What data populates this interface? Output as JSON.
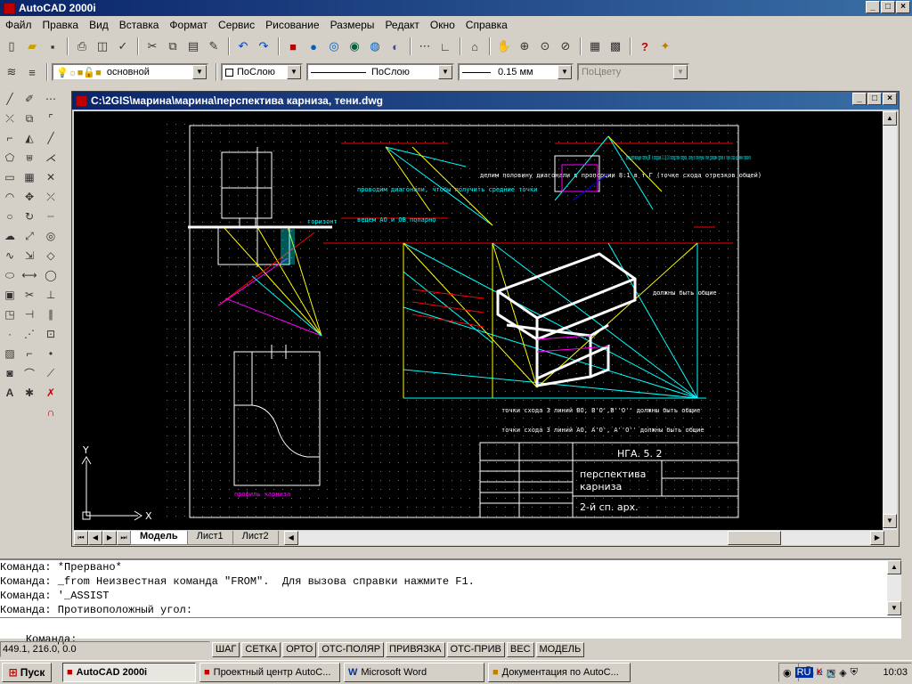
{
  "window": {
    "title": "AutoCAD 2000i",
    "controls": [
      "_",
      "□",
      "×"
    ]
  },
  "menu": [
    "Файл",
    "Правка",
    "Вид",
    "Вставка",
    "Формат",
    "Сервис",
    "Рисование",
    "Размеры",
    "Редакт",
    "Окно",
    "Справка"
  ],
  "layers": {
    "current_layer": "основной",
    "color": "ПоСлою",
    "linetype": "ПоСлою",
    "lineweight": "0.15 мм",
    "plotstyle": "ПоЦвету"
  },
  "drawing": {
    "title": "C:\\2GIS\\марина\\марина\\перспектива карниза, тени.dwg",
    "tabs": [
      "Модель",
      "Лист1",
      "Лист2"
    ],
    "active_tab": "Модель",
    "notes": {
      "divide_halves": "делим половину диагонали в пропорции 8:1 в т.Г (точке схода отрезков общей)",
      "draw_diag": "проводим диагонали, чтобы получить средние точки",
      "draw_lines": "ведем АО и ОВ попарно",
      "vertical_note": "делим вертикальные отрезки BB' в пропорции 1:1:8:1:8 посредством отрезков, затем из полученных точек проводим отрезки в точки схода на линии горизонта",
      "must_be_common": "должны быть общие",
      "vp_note_1": "точки схода 3 линий ВО, В'О',В''О'' должны быть общие",
      "vp_note_2": "точки схода 3 линий АО, А'О', А''О'' должны быть общие",
      "profile_label": "профиль карниза",
      "horizon": "горизонт"
    },
    "title_block": {
      "code": "НГА. 5. 2",
      "name_line1": "перспектива",
      "name_line2": "карниза",
      "course": "2-й сп. арх."
    },
    "ucs": {
      "x": "X",
      "y": "Y"
    }
  },
  "command": {
    "history": [
      "Команда: *Прервано*",
      "Команда: _from Неизвестная команда \"FROM\".  Для вызова справки нажмите F1.",
      "Команда: '_ASSIST",
      "Команда: Противоположный угол:"
    ],
    "prompt": "Команда:"
  },
  "status": {
    "coords": "449.1, 216.0, 0.0",
    "toggles": [
      "ШАГ",
      "СЕТКА",
      "ОРТО",
      "ОТС-ПОЛЯР",
      "ПРИВЯЗКА",
      "ОТС-ПРИВ",
      "ВЕС",
      "МОДЕЛЬ"
    ]
  },
  "taskbar": {
    "start": "Пуск",
    "tasks": [
      "AutoCAD 2000i",
      "Проектный центр AutoC...",
      "Microsoft Word",
      "Документация по AutoC..."
    ],
    "active_task": "AutoCAD 2000i",
    "lang": "RU",
    "time": "10:03"
  }
}
